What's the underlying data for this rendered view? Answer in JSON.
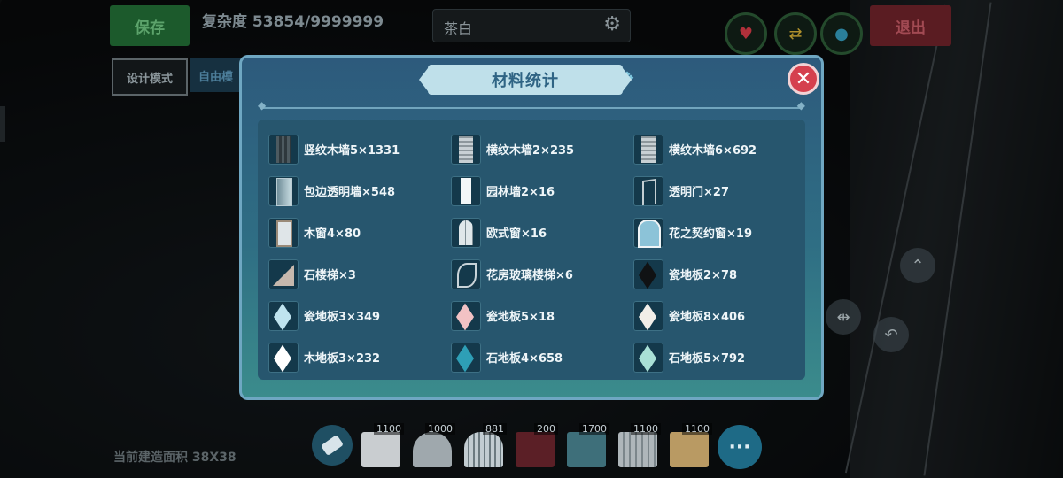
{
  "hud": {
    "save_label": "保存",
    "complexity_label": "复杂度 53854/9999999",
    "color_value": "茶白",
    "design_mode_label": "设计模式",
    "free_mode_label": "自由模",
    "exit_label": "退出",
    "area_label": "当前建造面积 38X38"
  },
  "toolbar": {
    "items": [
      {
        "count": "1100",
        "color": "#c9cdd0"
      },
      {
        "count": "1000",
        "color": "#9fa8ad"
      },
      {
        "count": "881",
        "color": "#c2ccd1"
      },
      {
        "count": "200",
        "color": "#5b1f26"
      },
      {
        "count": "1700",
        "color": "#3e6f7a"
      },
      {
        "count": "1100",
        "color": "#aeb6ba"
      },
      {
        "count": "1100",
        "color": "#b99a63"
      }
    ],
    "more_label": "···"
  },
  "modal": {
    "title": "材料统计",
    "close_label": "✕",
    "items": [
      {
        "name": "竖纹木墙5×1331",
        "icon": "vertical-wood-wall"
      },
      {
        "name": "横纹木墙2×235",
        "icon": "horizontal-wood-wall"
      },
      {
        "name": "横纹木墙6×692",
        "icon": "horizontal-wood-wall"
      },
      {
        "name": "包边透明墙×548",
        "icon": "glass-wall"
      },
      {
        "name": "园林墙2×16",
        "icon": "garden-wall"
      },
      {
        "name": "透明门×27",
        "icon": "glass-door"
      },
      {
        "name": "木窗4×80",
        "icon": "wood-window"
      },
      {
        "name": "欧式窗×16",
        "icon": "european-window"
      },
      {
        "name": "花之契约窗×19",
        "icon": "flower-window"
      },
      {
        "name": "石楼梯×3",
        "icon": "stone-stairs"
      },
      {
        "name": "花房玻璃楼梯×6",
        "icon": "spiral-glass-stairs"
      },
      {
        "name": "瓷地板2×78",
        "icon": "tile-black"
      },
      {
        "name": "瓷地板3×349",
        "icon": "tile-lightblue"
      },
      {
        "name": "瓷地板5×18",
        "icon": "tile-pink"
      },
      {
        "name": "瓷地板8×406",
        "icon": "tile-white"
      },
      {
        "name": "木地板3×232",
        "icon": "tile-white2"
      },
      {
        "name": "石地板4×658",
        "icon": "tile-teal"
      },
      {
        "name": "石地板5×792",
        "icon": "tile-mint"
      }
    ]
  },
  "colors": {
    "modal_top": "#2d5a7c",
    "modal_bottom": "#3b8c8c",
    "title_text": "#2f6484",
    "close_red": "#d5404e"
  }
}
